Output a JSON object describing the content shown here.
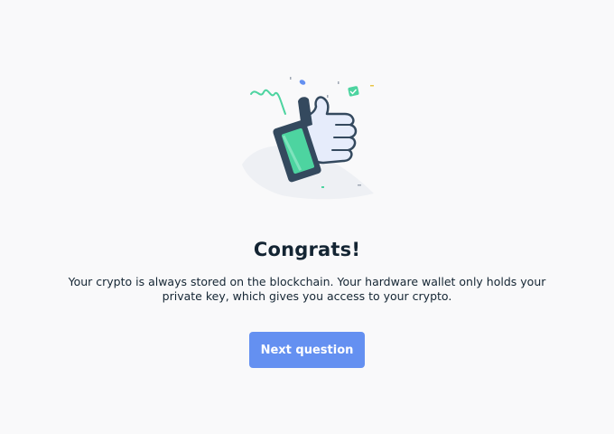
{
  "screen": {
    "illustration_icon": "thumbs-up-with-device-icon",
    "title": "Congrats!",
    "message_line1": "Your crypto is always stored on the blockchain. Your hardware wallet only holds your",
    "message_line2": "private key, which gives you access to your crypto.",
    "next_button_label": "Next question"
  },
  "colors": {
    "background": "#f9f9fa",
    "primary": "#6490f1",
    "text": "#142533",
    "accent_green": "#4dd4a0"
  }
}
